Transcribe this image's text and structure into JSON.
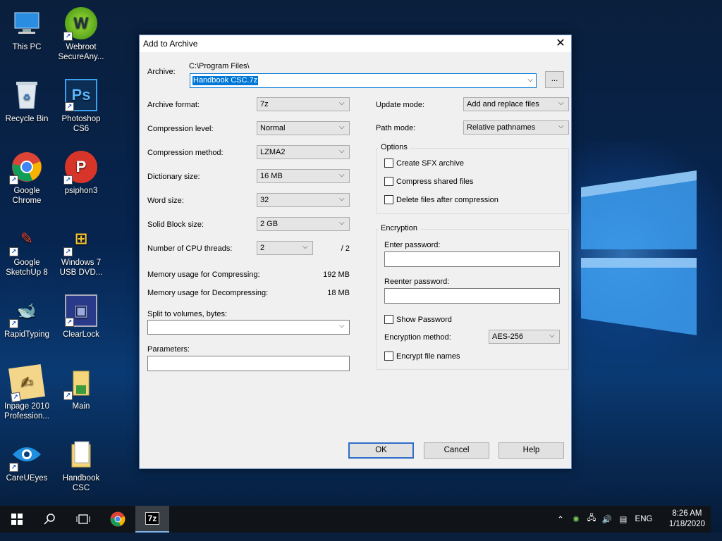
{
  "desktop": {
    "icons": [
      {
        "label": "This PC",
        "glyph": "🖥"
      },
      {
        "label": "Webroot SecureAny...",
        "glyph": "W"
      },
      {
        "label": "Recycle Bin",
        "glyph": "♻"
      },
      {
        "label": "Photoshop CS6",
        "glyph": "Ps"
      },
      {
        "label": "Google Chrome",
        "glyph": ""
      },
      {
        "label": "psiphon3",
        "glyph": "P"
      },
      {
        "label": "Google SketchUp 8",
        "glyph": "✎"
      },
      {
        "label": "Windows 7 USB DVD...",
        "glyph": "⊞"
      },
      {
        "label": "RapidTyping",
        "glyph": "🐋"
      },
      {
        "label": "ClearLock",
        "glyph": "▣"
      },
      {
        "label": "Inpage 2010 Profession...",
        "glyph": "✍"
      },
      {
        "label": "Main",
        "glyph": "📁"
      },
      {
        "label": "CareUEyes",
        "glyph": "👁"
      },
      {
        "label": "Handbook CSC",
        "glyph": "📁"
      }
    ]
  },
  "dialog": {
    "title": "Add to Archive",
    "archive_label": "Archive:",
    "archive_path": "C:\\Program Files\\",
    "archive_name": "Handbook CSC.7z",
    "browse_label": "...",
    "archive_format_label": "Archive format:",
    "archive_format": "7z",
    "compression_level_label": "Compression level:",
    "compression_level": "Normal",
    "compression_method_label": "Compression method:",
    "compression_method": "LZMA2",
    "dictionary_size_label": "Dictionary size:",
    "dictionary_size": "16 MB",
    "word_size_label": "Word size:",
    "word_size": "32",
    "solid_block_label": "Solid Block size:",
    "solid_block": "2 GB",
    "cpu_threads_label": "Number of CPU threads:",
    "cpu_threads": "2",
    "cpu_threads_max": "/ 2",
    "mem_compress_label": "Memory usage for Compressing:",
    "mem_compress": "192 MB",
    "mem_decompress_label": "Memory usage for Decompressing:",
    "mem_decompress": "18 MB",
    "split_label": "Split to volumes, bytes:",
    "split_value": "",
    "parameters_label": "Parameters:",
    "update_mode_label": "Update mode:",
    "update_mode": "Add and replace files",
    "path_mode_label": "Path mode:",
    "path_mode": "Relative pathnames",
    "options_title": "Options",
    "opt_sfx": "Create SFX archive",
    "opt_shared": "Compress shared files",
    "opt_delete": "Delete files after compression",
    "encryption_title": "Encryption",
    "enter_password_label": "Enter password:",
    "reenter_password_label": "Reenter password:",
    "show_password": "Show Password",
    "encryption_method_label": "Encryption method:",
    "encryption_method": "AES-256",
    "encrypt_names": "Encrypt file names",
    "ok": "OK",
    "cancel": "Cancel",
    "help": "Help"
  },
  "taskbar": {
    "app_7z": "7z",
    "lang": "ENG",
    "time": "8:26 AM",
    "date": "1/18/2020"
  }
}
